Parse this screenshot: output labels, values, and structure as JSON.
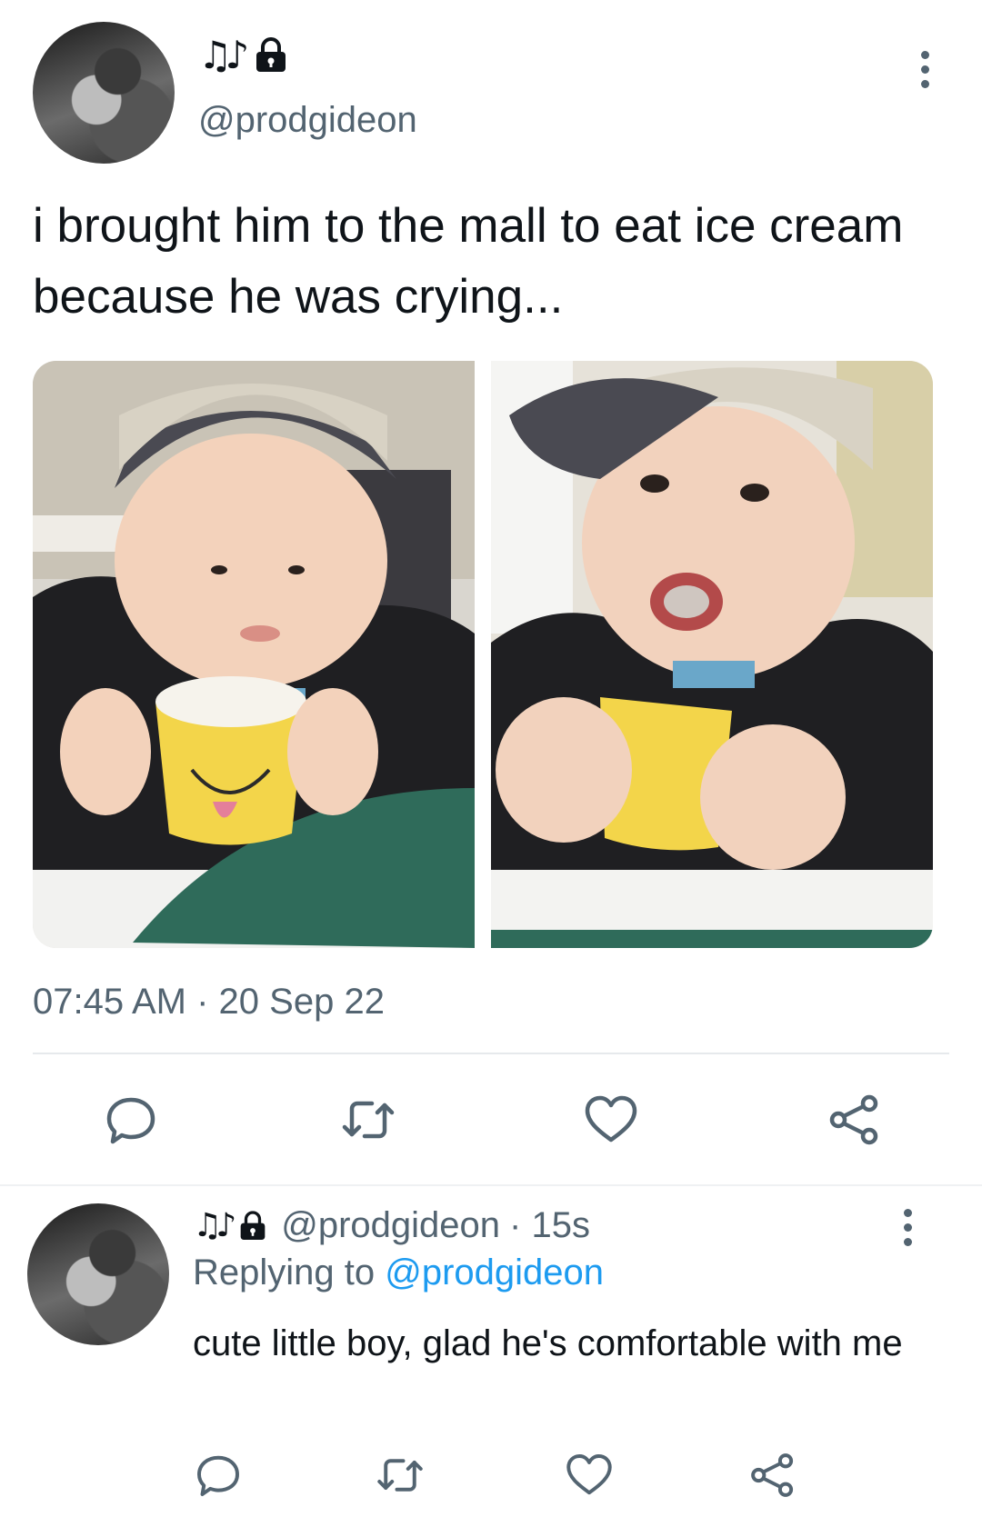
{
  "tweet": {
    "name_emoji": "♫♪",
    "handle": "@prodgideon",
    "text": "i brought him to the mall to eat ice cream because he was crying...",
    "timestamp": "07:45 AM · 20 Sep 22"
  },
  "reply": {
    "name_emoji": "♫♪",
    "handle": "@prodgideon",
    "time": "· 15s",
    "replying_prefix": "Replying to",
    "replying_to": "@prodgideon",
    "text": "cute little boy, glad he's comfortable with me"
  },
  "colors": {
    "text_primary": "#0f1419",
    "text_secondary": "#536471",
    "link": "#1d9bf0",
    "divider": "#e6e9ec"
  },
  "icons": {
    "reply": "speech-bubble-icon",
    "retweet": "retweet-icon",
    "like": "heart-icon",
    "share": "share-icon",
    "more": "more-vertical-icon",
    "lock": "lock-icon"
  }
}
